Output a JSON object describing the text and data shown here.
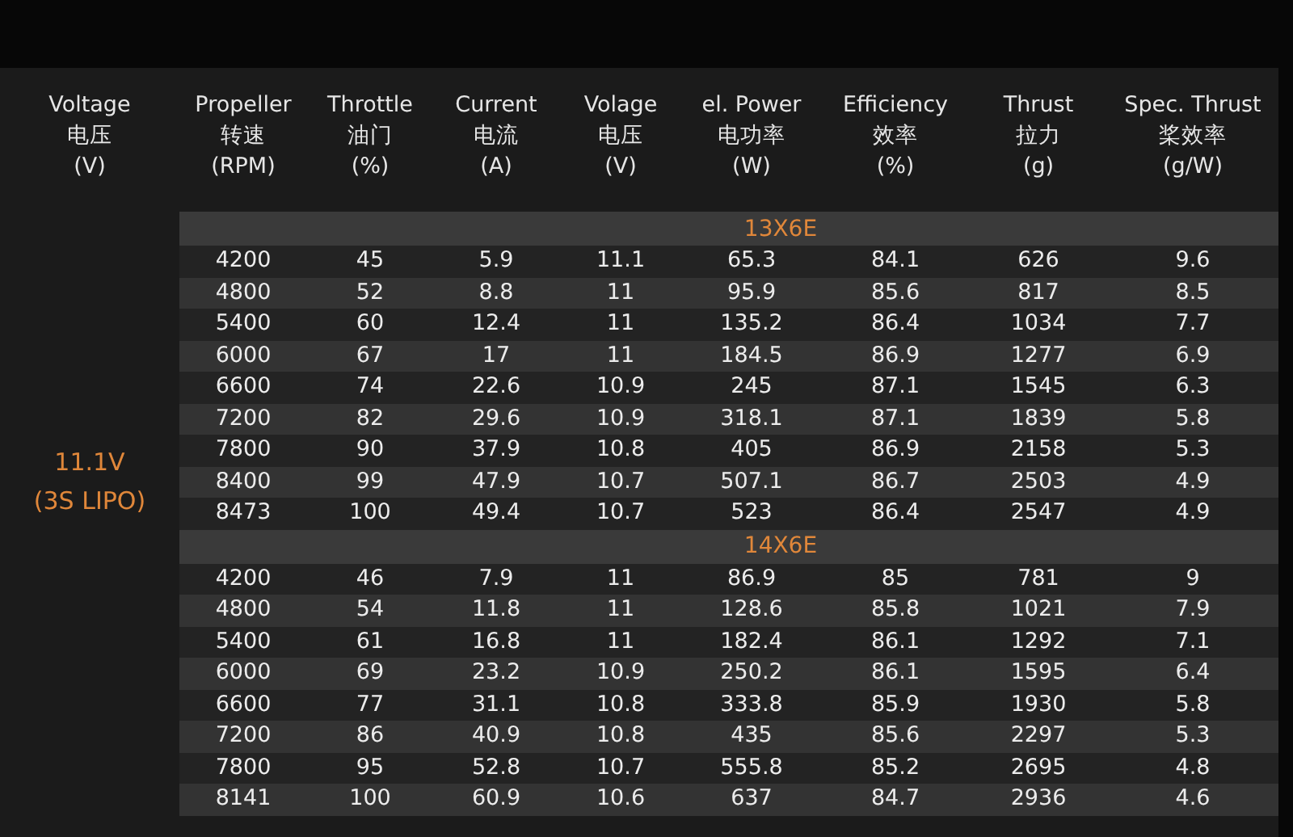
{
  "columns": [
    {
      "label": "Voltage",
      "label_zh": "电压",
      "unit": "(V)"
    },
    {
      "label": "Propeller",
      "label_zh": "转速",
      "unit": "(RPM)"
    },
    {
      "label": "Throttle",
      "label_zh": "油门",
      "unit": "(%)"
    },
    {
      "label": "Current",
      "label_zh": "电流",
      "unit": "(A)"
    },
    {
      "label": "Volage",
      "label_zh": "电压",
      "unit": "(V)"
    },
    {
      "label": "el. Power",
      "label_zh": "电功率",
      "unit": "(W)"
    },
    {
      "label": "Efficiency",
      "label_zh": "效率",
      "unit": "(%)"
    },
    {
      "label": "Thrust",
      "label_zh": "拉力",
      "unit": "(g)"
    },
    {
      "label": "Spec. Thrust",
      "label_zh": "桨效率",
      "unit": "(g/W)"
    }
  ],
  "voltage": {
    "value": "11.1V",
    "battery": "(3S LIPO)"
  },
  "groups": [
    {
      "propeller": "13X6E",
      "rows": [
        [
          "4200",
          "45",
          "5.9",
          "11.1",
          "65.3",
          "84.1",
          "626",
          "9.6"
        ],
        [
          "4800",
          "52",
          "8.8",
          "11",
          "95.9",
          "85.6",
          "817",
          "8.5"
        ],
        [
          "5400",
          "60",
          "12.4",
          "11",
          "135.2",
          "86.4",
          "1034",
          "7.7"
        ],
        [
          "6000",
          "67",
          "17",
          "11",
          "184.5",
          "86.9",
          "1277",
          "6.9"
        ],
        [
          "6600",
          "74",
          "22.6",
          "10.9",
          "245",
          "87.1",
          "1545",
          "6.3"
        ],
        [
          "7200",
          "82",
          "29.6",
          "10.9",
          "318.1",
          "87.1",
          "1839",
          "5.8"
        ],
        [
          "7800",
          "90",
          "37.9",
          "10.8",
          "405",
          "86.9",
          "2158",
          "5.3"
        ],
        [
          "8400",
          "99",
          "47.9",
          "10.7",
          "507.1",
          "86.7",
          "2503",
          "4.9"
        ],
        [
          "8473",
          "100",
          "49.4",
          "10.7",
          "523",
          "86.4",
          "2547",
          "4.9"
        ]
      ]
    },
    {
      "propeller": "14X6E",
      "rows": [
        [
          "4200",
          "46",
          "7.9",
          "11",
          "86.9",
          "85",
          "781",
          "9"
        ],
        [
          "4800",
          "54",
          "11.8",
          "11",
          "128.6",
          "85.8",
          "1021",
          "7.9"
        ],
        [
          "5400",
          "61",
          "16.8",
          "11",
          "182.4",
          "86.1",
          "1292",
          "7.1"
        ],
        [
          "6000",
          "69",
          "23.2",
          "10.9",
          "250.2",
          "86.1",
          "1595",
          "6.4"
        ],
        [
          "6600",
          "77",
          "31.1",
          "10.8",
          "333.8",
          "85.9",
          "1930",
          "5.8"
        ],
        [
          "7200",
          "86",
          "40.9",
          "10.8",
          "435",
          "85.6",
          "2297",
          "5.3"
        ],
        [
          "7800",
          "95",
          "52.8",
          "10.7",
          "555.8",
          "85.2",
          "2695",
          "4.8"
        ],
        [
          "8141",
          "100",
          "60.9",
          "10.6",
          "637",
          "84.7",
          "2936",
          "4.6"
        ]
      ]
    }
  ]
}
